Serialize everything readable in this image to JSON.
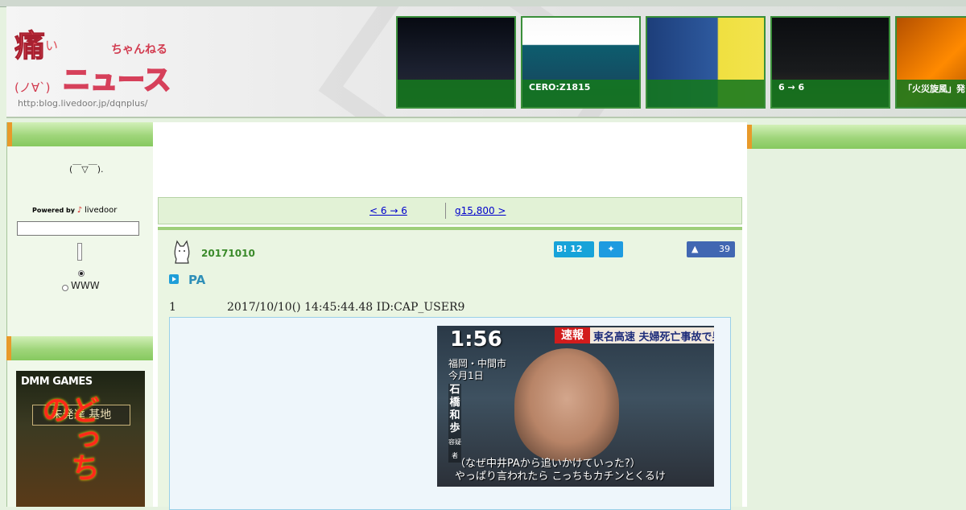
{
  "header": {
    "logo_main": "痛いニュース",
    "logo_sub": "(ノ∀`)",
    "logo_ruby": "ちゃんねる",
    "logo_url": "http:blog.livedoor.jp/dqnplus/"
  },
  "thumbnails": [
    {
      "caption": ""
    },
    {
      "caption": "CERO:Z1815"
    },
    {
      "caption": ""
    },
    {
      "caption": "6 → 6"
    },
    {
      "caption": "「火災旋風」発"
    }
  ],
  "sidebar": {
    "kaomoji": "(￣▽￣).",
    "powered_by": "Powered by",
    "powered_brand": "livedoor",
    "radio_www": "WWW",
    "ad": {
      "brand": "DMM GAMES",
      "subtitle": "未発達 基地",
      "headline": "どっちの"
    }
  },
  "nav": {
    "prev_label": "< 6 → 6",
    "next_label": "g15,800 >"
  },
  "entry": {
    "date": "20171010",
    "category": "PA",
    "hatena_count": "12",
    "hatena_label": "B!",
    "fb_count": "39",
    "post_number": "1",
    "post_meta": "2017/10/10() 14:45:44.48 ID:CAP_USER9",
    "tv": {
      "time": "1:56",
      "breaking": "速報",
      "headline": "東名高速 夫婦死亡事故で男を逮",
      "location": "福岡・中間市",
      "location_date": "今月1日",
      "name": "石橋和歩",
      "suffix": "容疑者",
      "subtitle1": "（なぜ中井PAから追いかけていった?）",
      "subtitle2": "やっぱり言われたら こっちもカチンとくるけ"
    }
  },
  "colors": {
    "accent_green": "#86c95f",
    "link_blue": "#0000cc",
    "date_green": "#3a8a2a"
  }
}
